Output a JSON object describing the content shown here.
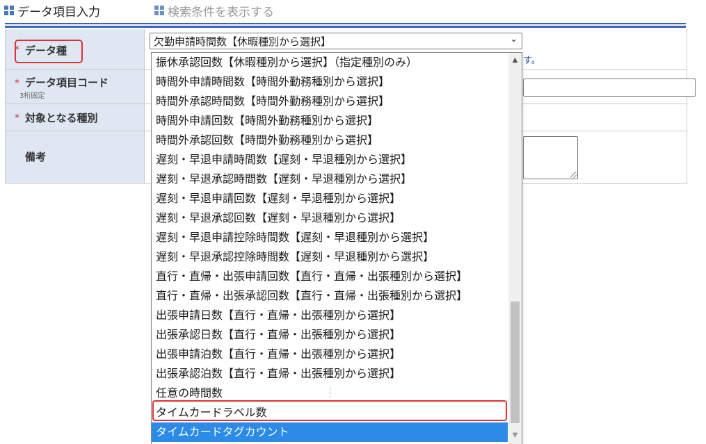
{
  "tabs": [
    {
      "label": "データ項目入力"
    },
    {
      "label": "検索条件を表示する"
    }
  ],
  "form": {
    "required_mark": "*",
    "data_type_label": "データ種",
    "code_label": "データ項目コード",
    "code_sub": "3桁固定",
    "target_label": "対象となる種別",
    "note_label": "備考",
    "hint_fragment": "す。"
  },
  "select": {
    "value": "欠勤申請時間数【休暇種別から選択】",
    "chevron": "⌄"
  },
  "options": [
    "振休承認回数【休暇種別から選択】（指定種別のみ）",
    "時間外申請時間数【時間外勤務種別から選択】",
    "時間外承認時間数【時間外勤務種別から選択】",
    "時間外申請回数【時間外勤務種別から選択】",
    "時間外承認回数【時間外勤務種別から選択】",
    "遅刻・早退申請時間数【遅刻・早退種別から選択】",
    "遅刻・早退承認時間数【遅刻・早退種別から選択】",
    "遅刻・早退申請回数【遅刻・早退種別から選択】",
    "遅刻・早退承認回数【遅刻・早退種別から選択】",
    "遅刻・早退申請控除時間数【遅刻・早退種別から選択】",
    "遅刻・早退承認控除時間数【遅刻・早退種別から選択】",
    "直行・直帰・出張申請回数【直行・直帰・出張種別から選択】",
    "直行・直帰・出張承認回数【直行・直帰・出張種別から選択】",
    "出張申請日数【直行・直帰・出張種別から選択】",
    "出張承認日数【直行・直帰・出張種別から選択】",
    "出張申請泊数【直行・直帰・出張種別から選択】",
    "出張承認泊数【直行・直帰・出張種別から選択】",
    "任意の時間数",
    "タイムカードラベル数",
    "タイムカードタグカウント"
  ],
  "highlighted_option_index": 18,
  "selected_option_index": 19,
  "scrollbar": {
    "up": "▲",
    "down": "▼"
  },
  "colors": {
    "accent": "#3a62b8",
    "label_bg": "#dfe7f3",
    "highlight": "#e03030",
    "selected": "#2b8be6"
  }
}
